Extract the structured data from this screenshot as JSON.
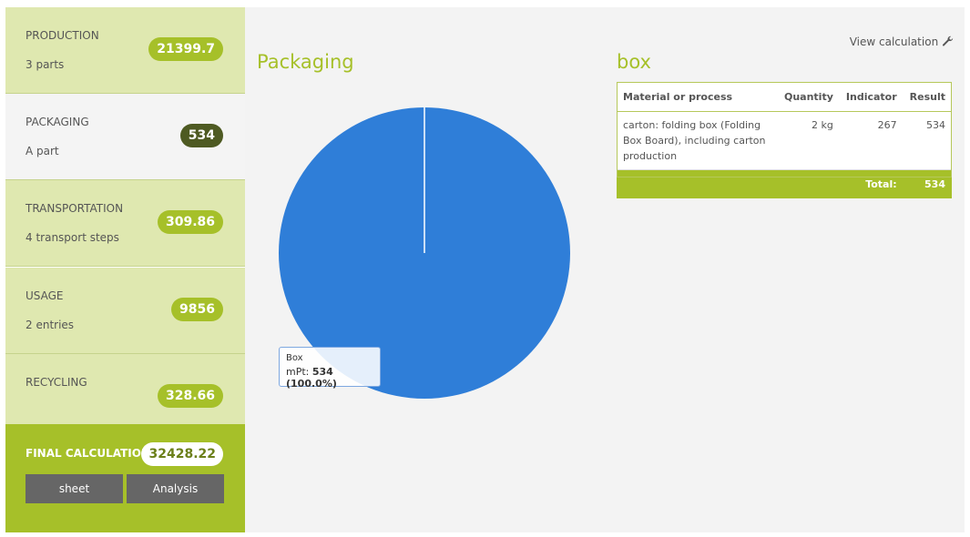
{
  "sidebar": {
    "items": [
      {
        "title": "PRODUCTION",
        "subtitle": "3 parts",
        "value": "21399.7"
      },
      {
        "title": "PACKAGING",
        "subtitle": "A part",
        "value": "534"
      },
      {
        "title": "TRANSPORTATION",
        "subtitle": "4 transport steps",
        "value": "309.86"
      },
      {
        "title": "USAGE",
        "subtitle": "2 entries",
        "value": "9856"
      },
      {
        "title": "RECYCLING",
        "subtitle": "",
        "value": "328.66"
      }
    ],
    "final": {
      "title": "FINAL CALCULATION",
      "value": "32428.22",
      "sheet_label": "sheet",
      "analysis_label": "Analysis"
    }
  },
  "main": {
    "section_title": "Packaging",
    "detail_title": "box",
    "view_calculation": "View calculation",
    "table": {
      "headers": [
        "Material or process",
        "Quantity",
        "Indicator",
        "Result"
      ],
      "rows": [
        {
          "material": "carton: folding box (Folding Box Board), including carton production",
          "quantity": "2 kg",
          "indicator": "267",
          "result": "534"
        }
      ],
      "total_label": "Total:",
      "total_value": "534"
    },
    "tooltip": {
      "name": "Box",
      "label": "mPt:",
      "value": "534 (100.0%)"
    }
  },
  "chart_data": {
    "type": "pie",
    "categories": [
      "Box"
    ],
    "values": [
      534
    ],
    "percent": [
      100.0
    ],
    "colors": [
      "#2f7ed8"
    ]
  },
  "colors": {
    "accent": "#a6c029",
    "dark_badge": "#4e5a22",
    "pie": "#2f7ed8"
  }
}
